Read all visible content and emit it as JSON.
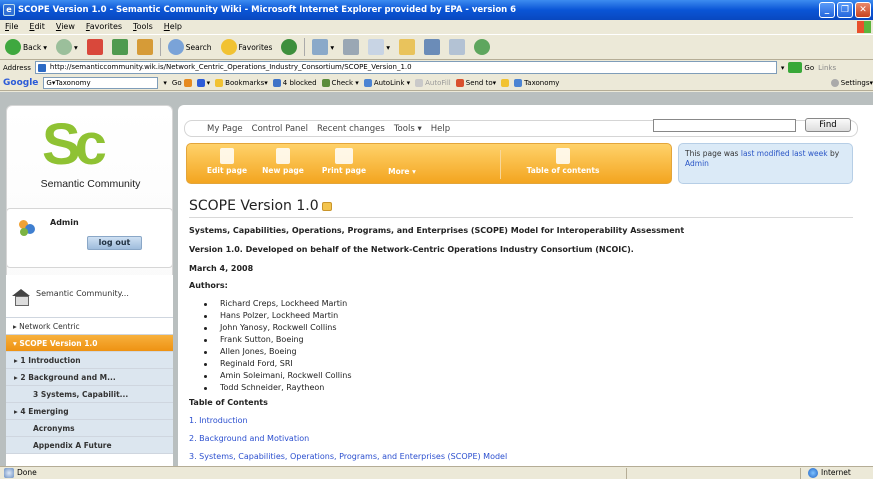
{
  "window": {
    "title": "SCOPE Version 1.0 - Semantic Community Wiki - Microsoft Internet Explorer provided by EPA - version 6"
  },
  "menu": [
    "File",
    "Edit",
    "View",
    "Favorites",
    "Tools",
    "Help"
  ],
  "toolbar": {
    "back": "Back",
    "search": "Search",
    "favorites": "Favorites"
  },
  "address": {
    "label": "Address",
    "url": "http://semanticcommunity.wik.is/Network_Centric_Operations_Industry_Consortium/SCOPE_Version_1.0",
    "go": "Go",
    "links": "Links"
  },
  "googlebar": {
    "logo": "Google",
    "search_value": "G▾Taxonomy",
    "go": "Go",
    "bookmarks": "Bookmarks▾",
    "blocked": "4 blocked",
    "check": "Check ▾",
    "autolink": "AutoLink ▾",
    "autofill": "AutoFill",
    "sendto": "Send to▾",
    "taxonomy": "Taxonomy",
    "settings": "Settings▾"
  },
  "site": {
    "name": "Semantic Community",
    "logo_text": "Sc"
  },
  "user": {
    "name": "Admin",
    "logout": "log out"
  },
  "nav": {
    "home": "Semantic Community...",
    "items": [
      {
        "label": "▸ Network Centric",
        "kind": "normal"
      },
      {
        "label": "▾ SCOPE Version 1.0",
        "kind": "active"
      },
      {
        "label": "▸ 1 Introduction",
        "kind": "sub"
      },
      {
        "label": "▸ 2 Background and M...",
        "kind": "sub"
      },
      {
        "label": "3 Systems, Capabilit...",
        "kind": "l2"
      },
      {
        "label": "▸ 4 Emerging",
        "kind": "sub"
      },
      {
        "label": "Acronyms",
        "kind": "l2"
      },
      {
        "label": "Appendix A Future",
        "kind": "l2"
      }
    ]
  },
  "topnav": {
    "items": [
      "My Page",
      "Control Panel",
      "Recent changes",
      "Tools ▾",
      "Help"
    ],
    "find": "Find"
  },
  "actions": {
    "edit": "Edit page",
    "new": "New page",
    "print": "Print page",
    "more": "More ▾",
    "toc": "Table of contents"
  },
  "modified": {
    "prefix": "This page was ",
    "link": "last modified last week",
    "by": " by ",
    "author": "Admin"
  },
  "page": {
    "title": "SCOPE Version 1.0",
    "line1": "Systems, Capabilities, Operations, Programs, and Enterprises (SCOPE) Model for Interoperability Assessment",
    "line2": "Version 1.0. Developed on behalf of the Network-Centric Operations Industry Consortium (NCOIC).",
    "date": "March 4, 2008",
    "authors_heading": "Authors:",
    "authors": [
      "Richard Creps, Lockheed Martin",
      "Hans Polzer, Lockheed Martin",
      "John Yanosy, Rockwell Collins",
      "Frank Sutton, Boeing",
      "Allen Jones, Boeing",
      "Reginald Ford, SRI",
      "Amin Soleimani, Rockwell Collins",
      "Todd Schneider, Raytheon"
    ],
    "toc_heading": "Table of Contents",
    "toc": [
      "1. Introduction",
      "2. Background and Motivation",
      "3. Systems, Capabilities, Operations, Programs, and Enterprises (SCOPE) Model"
    ]
  },
  "status": {
    "left": "Done",
    "zone": "Internet"
  }
}
